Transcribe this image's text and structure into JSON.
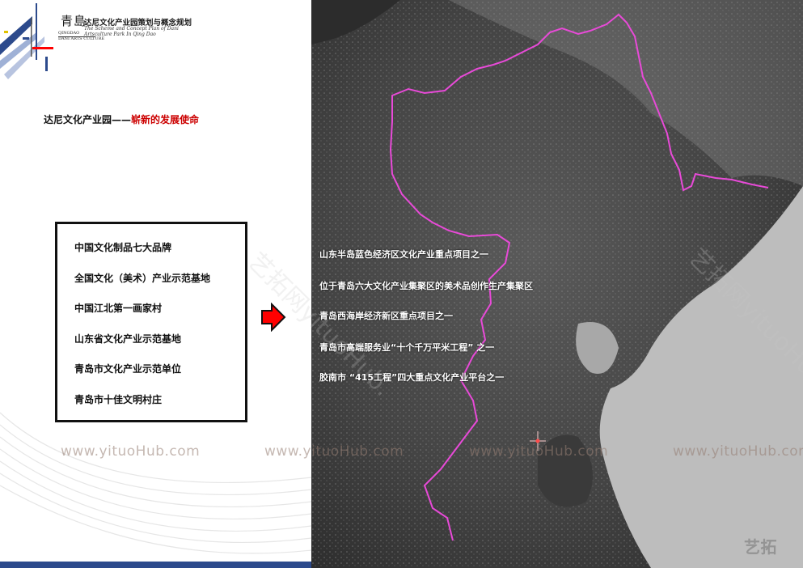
{
  "header": {
    "logo_cn": "青島",
    "logo_en_line1": "QINGDAO",
    "logo_en_line2": "DANI ARTS CULTURE",
    "title": "达尼文化产业园策划与概念规划",
    "title_en_line1": "The Scheme and Concept Plan of Dani",
    "title_en_line2": "Artsculture Park In Qing Dao"
  },
  "section": {
    "title": "达尼文化产业园——",
    "highlight": "崭新的发展使命"
  },
  "honors": [
    "中国文化制品七大品牌",
    "全国文化（美术）产业示范基地",
    "中国江北第一画家村",
    "山东省文化产业示范基地",
    "青岛市文化产业示范单位",
    "青岛市十佳文明村庄"
  ],
  "map_items": [
    "山东半岛蓝色经济区文化产业重点项目之一",
    "位于青岛六大文化产业集聚区的美术品创作生产集聚区",
    "青岛西海岸经济新区重点项目之一",
    "青岛市高端服务业“十个千万平米工程” 之一",
    "胶南市 “415工程”四大重点文化产业平台之一"
  ],
  "watermarks": {
    "url_text": "www.yituoHub.com",
    "diag_left": "艺拓网yituoHub.",
    "diag_right": "艺拓网yituoHub.",
    "corner": "艺拓"
  },
  "colors": {
    "boundary": "#e84ad8",
    "accent_red": "#cc0000",
    "brand_blue": "#2c4a8c",
    "map_bg": "#3a3a3a"
  }
}
